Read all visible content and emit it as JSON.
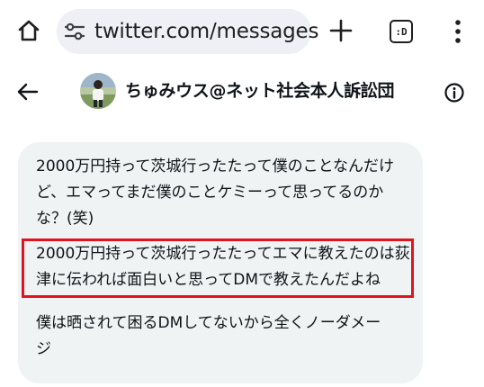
{
  "browser": {
    "url": "twitter.com/messages",
    "tab_count_label": ":D",
    "icons": {
      "home": "home-icon",
      "site_settings": "tune-icon",
      "new_tab": "plus-icon",
      "tabs": "tab-switcher-icon",
      "menu": "more-vert-icon"
    }
  },
  "conversation": {
    "title": "ちゅみウス@ネット社会本人訴訟団",
    "icons": {
      "back": "arrow-left-icon",
      "info": "info-icon"
    }
  },
  "message": {
    "paragraphs": [
      {
        "lines": [
          "2000万円持って茨城行ったたって僕のことなんだけ",
          "ど、エマってまだ僕のことケミーって思ってるのか",
          "な？(笑)"
        ]
      },
      {
        "lines": [
          "2000万円持って茨城行ったたってエマに教えたのは荻",
          "津に伝われば面白いと思ってDMで教えたんだよね"
        ],
        "highlighted": true
      },
      {
        "lines": [
          "僕は晒されて困るDMしてないから全くノーダメー",
          "ジ"
        ]
      }
    ]
  },
  "colors": {
    "bubble_bg": "#eff3f4",
    "highlight_border": "#e0141e",
    "url_pill_bg": "#eef0f6",
    "text": "#0f1419"
  }
}
